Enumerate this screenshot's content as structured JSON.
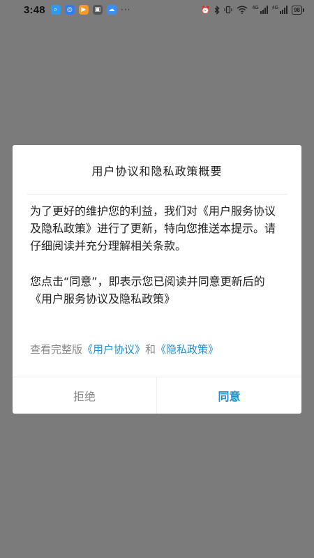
{
  "status_bar": {
    "time": "3:48",
    "more": "···",
    "network_label_1": "4G",
    "network_label_2": "4G",
    "battery": "98"
  },
  "dialog": {
    "title": "用户协议和隐私政策概要",
    "paragraph_1": "为了更好的维护您的利益，我们对《用户服务协议及隐私政策》进行了更新，特向您推送本提示。请仔细阅读并充分理解相关条款。",
    "paragraph_2": "您点击“同意”，即表示您已阅读并同意更新后的 《用户服务协议及隐私政策》",
    "links_prefix": "查看完整版",
    "user_agreement_link": "《用户协议》",
    "links_and": "和",
    "privacy_policy_link": "《隐私政策》",
    "reject_button": "拒绝",
    "agree_button": "同意"
  },
  "colors": {
    "overlay": "#7b7b7b",
    "accent": "#1f8fd1",
    "muted_text": "#888888"
  }
}
